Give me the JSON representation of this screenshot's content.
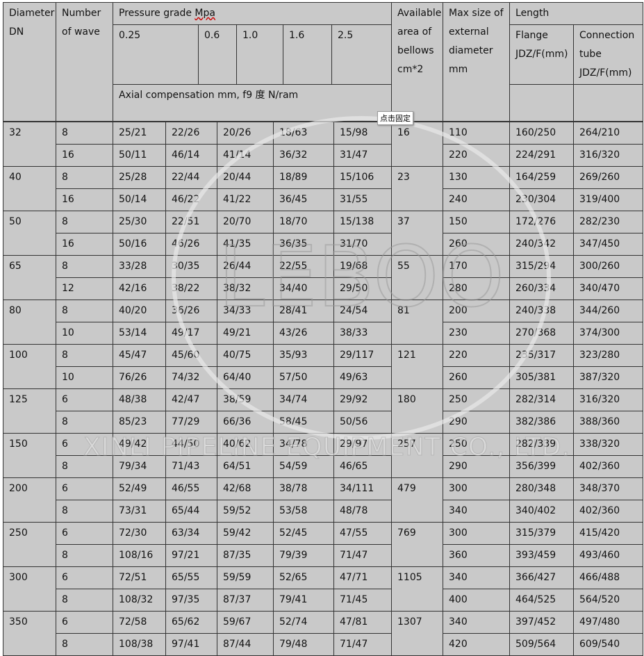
{
  "header": {
    "dn": "Diameter DN",
    "waves": "Number of wave",
    "pressure": "Pressure grade ",
    "pressure_unit": "Mpa",
    "grades": [
      "0.25",
      "0.6",
      "1.0",
      "1.6",
      "2.5"
    ],
    "axial": "Axial compensation mm, f9 度 N/ram",
    "area": "Available area of bellows cm*2",
    "maxsize": "Max size of external diameter mm",
    "length": "Length",
    "flange": "Flange JDZ/F(mm)",
    "tube": "Connection tube JDZ/F(mm)"
  },
  "groups": [
    {
      "dn": "32",
      "area": "16",
      "rows": [
        [
          "8",
          "25/21",
          "22/26",
          "20/26",
          "18/63",
          "15/98",
          "110",
          "160/250",
          "264/210"
        ],
        [
          "16",
          "50/11",
          "46/14",
          "41/14",
          "36/32",
          "31/47",
          "220",
          "224/291",
          "316/320"
        ]
      ]
    },
    {
      "dn": "40",
      "area": "23",
      "rows": [
        [
          "8",
          "25/28",
          "22/44",
          "20/44",
          "18/89",
          "15/106",
          "130",
          "164/259",
          "269/260"
        ],
        [
          "16",
          "50/14",
          "46/22",
          "41/22",
          "36/45",
          "31/55",
          "240",
          "230/304",
          "319/400"
        ]
      ]
    },
    {
      "dn": "50",
      "area": "37",
      "rows": [
        [
          "8",
          "25/30",
          "22/51",
          "20/70",
          "18/70",
          "15/138",
          "150",
          "172/276",
          "282/230"
        ],
        [
          "16",
          "50/16",
          "46/26",
          "41/35",
          "36/35",
          "31/70",
          "260",
          "240/342",
          "347/450"
        ]
      ]
    },
    {
      "dn": "65",
      "area": "55",
      "rows": [
        [
          "8",
          "33/28",
          "30/35",
          "26/44",
          "22/55",
          "19/68",
          "170",
          "315/294",
          "300/260"
        ],
        [
          "12",
          "42/16",
          "38/22",
          "38/32",
          "34/40",
          "29/50",
          "280",
          "260/334",
          "340/470"
        ]
      ]
    },
    {
      "dn": "80",
      "area": "81",
      "rows": [
        [
          "8",
          "40/20",
          "36/26",
          "34/33",
          "28/41",
          "24/54",
          "200",
          "240/338",
          "344/260"
        ],
        [
          "10",
          "53/14",
          "49/17",
          "49/21",
          "43/26",
          "38/33",
          "230",
          "270/368",
          "374/300"
        ]
      ]
    },
    {
      "dn": "100",
      "area": "121",
      "rows": [
        [
          "8",
          "45/47",
          "45/60",
          "40/75",
          "35/93",
          "29/117",
          "220",
          "235/317",
          "323/280"
        ],
        [
          "10",
          "76/26",
          "74/32",
          "64/40",
          "57/50",
          "49/63",
          "260",
          "305/381",
          "387/320"
        ]
      ]
    },
    {
      "dn": "125",
      "area": "180",
      "rows": [
        [
          "6",
          "48/38",
          "42/47",
          "38/59",
          "34/74",
          "29/92",
          "250",
          "282/314",
          "316/320"
        ],
        [
          "8",
          "85/23",
          "77/29",
          "66/36",
          "58/45",
          "50/56",
          "290",
          "382/386",
          "388/360"
        ]
      ]
    },
    {
      "dn": "150",
      "area": "257",
      "rows": [
        [
          "6",
          "49/42",
          "44/50",
          "40/62",
          "34/78",
          "29/97",
          "250",
          "282/339",
          "338/320"
        ],
        [
          "8",
          "79/34",
          "71/43",
          "64/51",
          "54/59",
          "46/65",
          "290",
          "356/399",
          "402/360"
        ]
      ]
    },
    {
      "dn": "200",
      "area": "479",
      "rows": [
        [
          "6",
          "52/49",
          "46/55",
          "42/68",
          "38/78",
          "34/111",
          "300",
          "280/348",
          "348/370"
        ],
        [
          "8",
          "73/31",
          "65/44",
          "59/52",
          "53/58",
          "48/78",
          "340",
          "340/402",
          "402/360"
        ]
      ]
    },
    {
      "dn": "250",
      "area": "769",
      "rows": [
        [
          "6",
          "72/30",
          "63/34",
          "59/42",
          "52/45",
          "47/55",
          "300",
          "315/379",
          "415/420"
        ],
        [
          "8",
          "108/16",
          "97/21",
          "87/35",
          "79/39",
          "71/47",
          "360",
          "393/459",
          "493/460"
        ]
      ]
    },
    {
      "dn": "300",
      "area": "1105",
      "rows": [
        [
          "6",
          "72/51",
          "65/55",
          "59/59",
          "52/65",
          "47/71",
          "340",
          "366/427",
          "466/488"
        ],
        [
          "8",
          "108/32",
          "97/35",
          "87/37",
          "79/41",
          "71/45",
          "400",
          "464/525",
          "564/520"
        ]
      ]
    },
    {
      "dn": "350",
      "area": "1307",
      "rows": [
        [
          "6",
          "72/58",
          "65/62",
          "59/67",
          "52/74",
          "47/81",
          "340",
          "397/452",
          "497/480"
        ],
        [
          "8",
          "108/38",
          "97/41",
          "87/44",
          "79/48",
          "71/47",
          "420",
          "509/564",
          "609/540"
        ]
      ]
    }
  ],
  "tooltip": "点击固定",
  "watermark": {
    "logo": "LEBOO",
    "company": "XINLI PIPELINE EQUIPMENT CO., LTD."
  }
}
